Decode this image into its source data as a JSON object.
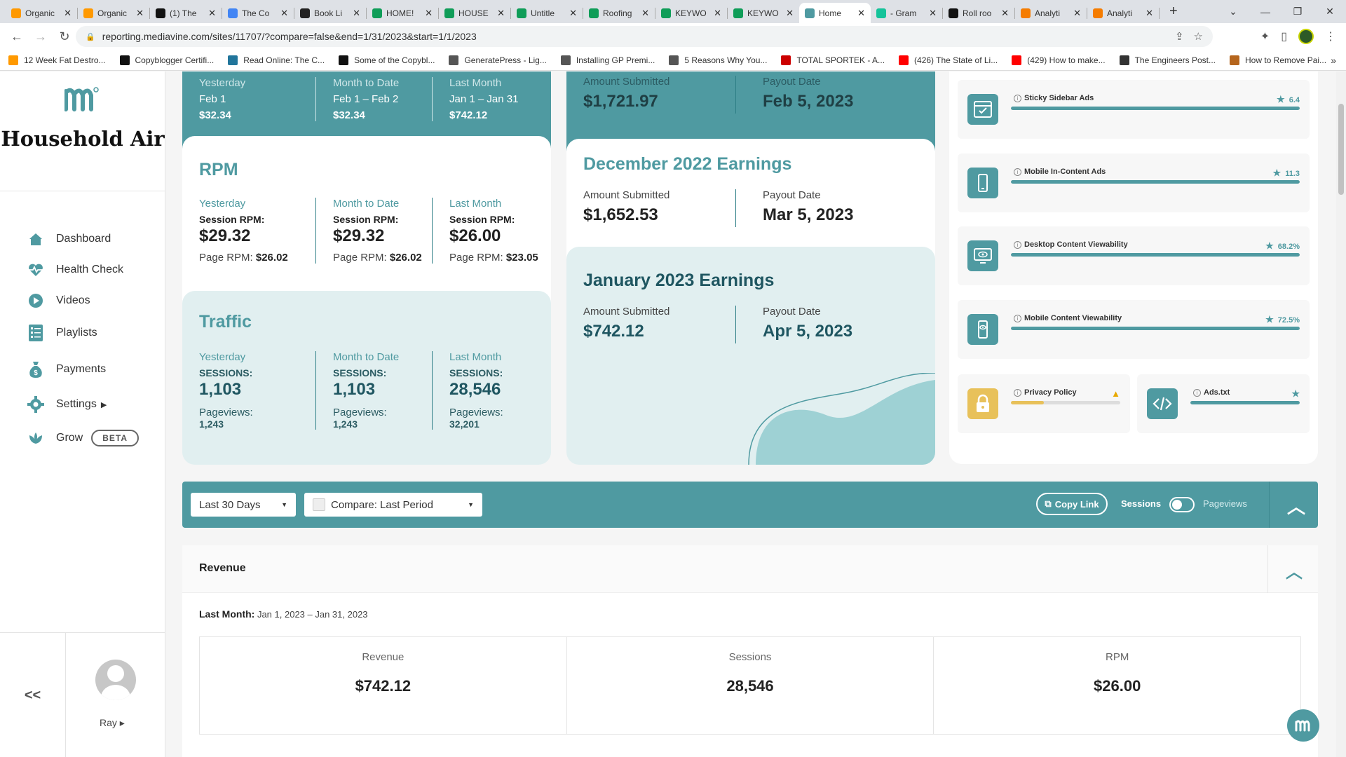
{
  "browser": {
    "tabs": [
      {
        "label": "Organic",
        "color": "#f90"
      },
      {
        "label": "Organic",
        "color": "#f90"
      },
      {
        "label": "(1) The",
        "color": "#111"
      },
      {
        "label": "The Co",
        "color": "#4285f4"
      },
      {
        "label": "Book Li",
        "color": "#222"
      },
      {
        "label": "HOME!",
        "color": "#0f9d58"
      },
      {
        "label": "HOUSE",
        "color": "#0f9d58"
      },
      {
        "label": "Untitle",
        "color": "#0f9d58"
      },
      {
        "label": "Roofing",
        "color": "#0f9d58"
      },
      {
        "label": "KEYWO",
        "color": "#0f9d58"
      },
      {
        "label": "KEYWO",
        "color": "#0f9d58"
      },
      {
        "label": "Home",
        "color": "#4f9aa1",
        "active": true
      },
      {
        "label": "- Gram",
        "color": "#15c39a"
      },
      {
        "label": "Roll roo",
        "color": "#111"
      },
      {
        "label": "Analyti",
        "color": "#f57c00"
      },
      {
        "label": "Analyti",
        "color": "#f57c00"
      }
    ],
    "url": "reporting.mediavine.com/sites/11707/?compare=false&end=1/31/2023&start=1/1/2023",
    "bookmarks": [
      {
        "label": "12 Week Fat Destro...",
        "color": "#f90"
      },
      {
        "label": "Copyblogger Certifi...",
        "color": "#111"
      },
      {
        "label": "Read Online: The C...",
        "color": "#21759b"
      },
      {
        "label": "Some of the Copybl...",
        "color": "#111"
      },
      {
        "label": "GeneratePress - Lig...",
        "color": "#555"
      },
      {
        "label": "Installing GP Premi...",
        "color": "#555"
      },
      {
        "label": "5 Reasons Why You...",
        "color": "#555"
      },
      {
        "label": "TOTAL SPORTEK - A...",
        "color": "#c00"
      },
      {
        "label": "(426) The State of Li...",
        "color": "#f00"
      },
      {
        "label": "(429) How to make...",
        "color": "#f00"
      },
      {
        "label": "The Engineers Post...",
        "color": "#333"
      },
      {
        "label": "How to Remove Pai...",
        "color": "#b5651d"
      }
    ]
  },
  "sidebar": {
    "site_name": "Household Air",
    "nav": [
      {
        "label": "Dashboard",
        "icon": "home-icon"
      },
      {
        "label": "Health Check",
        "icon": "heartbeat-icon"
      },
      {
        "label": "Videos",
        "icon": "play-icon"
      },
      {
        "label": "Playlists",
        "icon": "list-icon"
      },
      {
        "label": "Payments",
        "icon": "money-bag-icon"
      },
      {
        "label": "Settings",
        "icon": "gear-icon"
      },
      {
        "label": "Grow",
        "icon": "leaf-icon"
      }
    ],
    "beta_label": "BETA",
    "collapse_label": "<<",
    "user_name": "Ray"
  },
  "revenue_card": {
    "cols": [
      {
        "label": "Yesterday",
        "sub": "Feb 1",
        "value": "$32.34"
      },
      {
        "label": "Month to Date",
        "sub": "Feb 1 – Feb 2",
        "value": "$32.34"
      },
      {
        "label": "Last Month",
        "sub": "Jan 1 – Jan 31",
        "value": "$742.12"
      }
    ]
  },
  "rpm": {
    "title": "RPM",
    "cols": [
      {
        "label": "Yesterday",
        "session_label": "Session RPM:",
        "session": "$29.32",
        "page_label": "Page RPM:",
        "page": "$26.02"
      },
      {
        "label": "Month to Date",
        "session_label": "Session RPM:",
        "session": "$29.32",
        "page_label": "Page RPM:",
        "page": "$26.02"
      },
      {
        "label": "Last Month",
        "session_label": "Session RPM:",
        "session": "$26.00",
        "page_label": "Page RPM:",
        "page": "$23.05"
      }
    ]
  },
  "traffic": {
    "title": "Traffic",
    "cols": [
      {
        "label": "Yesterday",
        "sessions_label": "SESSIONS:",
        "sessions": "1,103",
        "pv_label": "Pageviews:",
        "pv": "1,243"
      },
      {
        "label": "Month to Date",
        "sessions_label": "SESSIONS:",
        "sessions": "1,103",
        "pv_label": "Pageviews:",
        "pv": "1,243"
      },
      {
        "label": "Last Month",
        "sessions_label": "SESSIONS:",
        "sessions": "28,546",
        "pv_label": "Pageviews:",
        "pv": "32,201"
      }
    ]
  },
  "earnings": {
    "top": {
      "amount_label": "Amount Submitted",
      "amount": "$1,721.97",
      "payout_label": "Payout Date",
      "payout": "Feb 5, 2023"
    },
    "december": {
      "title": "December 2022 Earnings",
      "amount_label": "Amount Submitted",
      "amount": "$1,652.53",
      "payout_label": "Payout Date",
      "payout": "Mar 5, 2023"
    },
    "january": {
      "title": "January 2023 Earnings",
      "amount_label": "Amount Submitted",
      "amount": "$742.12",
      "payout_label": "Payout Date",
      "payout": "Apr 5, 2023"
    }
  },
  "health": {
    "items": [
      {
        "name": "Sticky Sidebar Ads",
        "score": "6.4",
        "fill": 1.0,
        "icon": "sidebar-icon"
      },
      {
        "name": "Mobile In-Content Ads",
        "score": "11.3",
        "fill": 1.0,
        "icon": "mobile-icon"
      },
      {
        "name": "Desktop Content Viewability",
        "score": "68.2%",
        "fill": 1.0,
        "icon": "desktop-eye-icon"
      },
      {
        "name": "Mobile Content Viewability",
        "score": "72.5%",
        "fill": 1.0,
        "icon": "mobile-eye-icon"
      }
    ],
    "privacy": {
      "name": "Privacy Policy",
      "fill": 0.3,
      "color": "#e8c15a"
    },
    "adstxt": {
      "name": "Ads.txt",
      "fill": 1.0
    }
  },
  "toolbar": {
    "range": "Last 30 Days",
    "compare": "Compare: Last Period",
    "copy_link": "Copy Link",
    "sessions": "Sessions",
    "pageviews": "Pageviews"
  },
  "revenue_panel": {
    "title": "Revenue",
    "range_label": "Last Month:",
    "range": "Jan 1, 2023 – Jan 31, 2023",
    "cells": [
      {
        "label": "Revenue",
        "value": "$742.12"
      },
      {
        "label": "Sessions",
        "value": "28,546"
      },
      {
        "label": "RPM",
        "value": "$26.00"
      }
    ]
  },
  "colors": {
    "accent": "#4f9aa1",
    "light_accent": "#e1eff0",
    "warning": "#e8c15a"
  }
}
